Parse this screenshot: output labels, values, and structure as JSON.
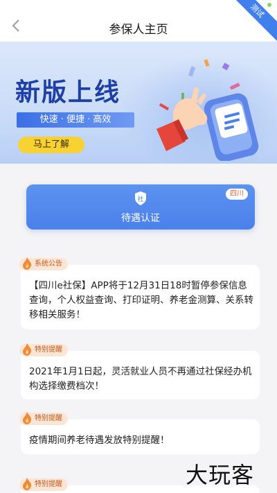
{
  "header": {
    "title": "参保人主页",
    "corner_badge": "测试"
  },
  "banner": {
    "title": "新版上线",
    "tagline": "快速 · 便捷 · 高效",
    "cta_label": "马上了解"
  },
  "service": {
    "icon_text": "社",
    "label": "待遇认证",
    "region": "四川"
  },
  "notices": [
    {
      "tag": "系统公告",
      "body": "【四川e社保】APP将于12月31日18时暂停参保信息查询，个人权益查询、打印证明、养老金测算、关系转移相关服务！"
    },
    {
      "tag": "特别提醒",
      "body": "2021年1月1日起，灵活就业人员不再通过社保经办机构选择缴费档次！"
    },
    {
      "tag": "特别提醒",
      "body": "疫情期间养老待遇发放特别提醒！"
    },
    {
      "tag": "特别提醒",
      "body": ""
    }
  ],
  "watermark": "大玩客",
  "colors": {
    "accent": "#4a80ea",
    "tag_bg": "#fbe6d6",
    "tag_text": "#c8591d",
    "cta": "#f8d132"
  }
}
